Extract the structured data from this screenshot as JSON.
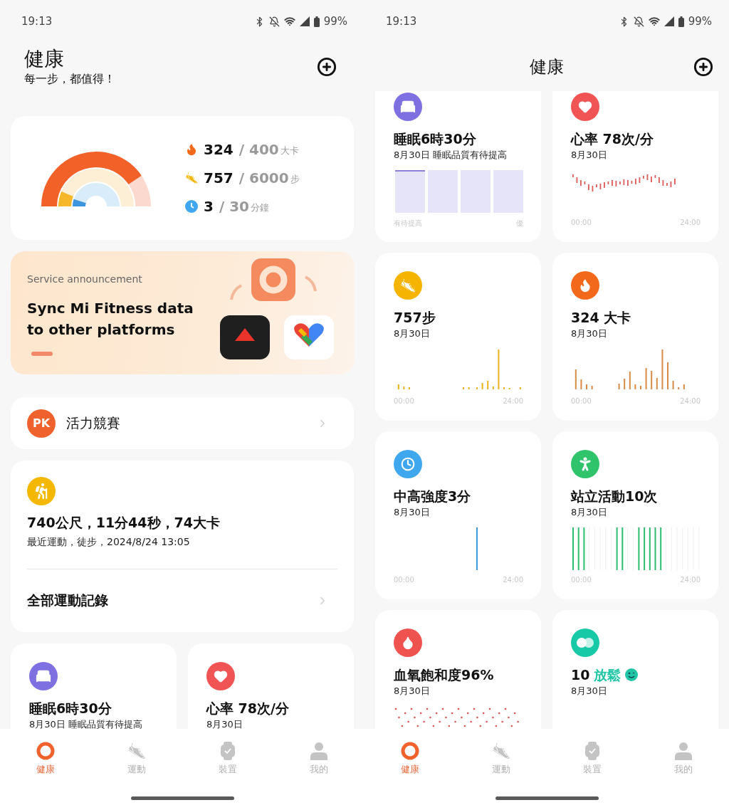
{
  "left_screen": {
    "status_bar": {
      "time": "19:13",
      "battery": "99%"
    },
    "header": {
      "title": "健康",
      "subtitle": "每一步，都值得！"
    },
    "goals": [
      {
        "kind": "calories",
        "value": "324",
        "target": "/ 400",
        "unit": "大卡"
      },
      {
        "kind": "steps",
        "value": "757",
        "target": "/ 6000",
        "unit": "步"
      },
      {
        "kind": "minutes",
        "value": "3",
        "target": "/ 30",
        "unit": "分鐘"
      }
    ],
    "announcement": {
      "label": "Service announcement",
      "title": "Sync Mi Fitness data to other platforms"
    },
    "challenge": {
      "badge": "PK",
      "label": "活力競賽"
    },
    "last_workout": {
      "summary": "740公尺，11分44秒，74大卡",
      "detail": "最近運動，徒步，2024/8/24 13:05",
      "link": "全部運動記錄"
    },
    "cards": [
      {
        "kind": "sleep",
        "title": "睡眠6時30分",
        "subtitle": "8月30日 睡眠品質有待提高"
      },
      {
        "kind": "heart_rate",
        "title": "心率 78次/分",
        "subtitle": "8月30日"
      }
    ],
    "nav": [
      {
        "kind": "health",
        "label": "健康",
        "selected": true
      },
      {
        "kind": "workout",
        "label": "運動",
        "selected": false
      },
      {
        "kind": "device",
        "label": "裝置",
        "selected": false
      },
      {
        "kind": "profile",
        "label": "我的",
        "selected": false
      }
    ]
  },
  "right_screen": {
    "status_bar": {
      "time": "19:13",
      "battery": "99%"
    },
    "header": {
      "title": "健康"
    },
    "cards": [
      {
        "kind": "sleep",
        "title": "睡眠6時30分",
        "subtitle": "8月30日 睡眠品質有待提高",
        "axis_start": "有待提高",
        "axis_end": "優"
      },
      {
        "kind": "heart_rate",
        "title": "心率 78次/分",
        "subtitle": "8月30日",
        "axis_start": "00:00",
        "axis_end": "24:00"
      },
      {
        "kind": "steps",
        "title": "757步",
        "subtitle": "8月30日",
        "axis_start": "00:00",
        "axis_end": "24:00"
      },
      {
        "kind": "calories",
        "title": "324 大卡",
        "subtitle": "8月30日",
        "axis_start": "00:00",
        "axis_end": "24:00"
      },
      {
        "kind": "intensity",
        "title": "中高強度3分",
        "subtitle": "8月30日",
        "axis_start": "00:00",
        "axis_end": "24:00"
      },
      {
        "kind": "standing",
        "title": "站立活動10次",
        "subtitle": "8月30日",
        "axis_start": "00:00",
        "axis_end": "24:00"
      },
      {
        "kind": "oxygen",
        "title": "血氧飽和度96%",
        "subtitle": "8月30日"
      },
      {
        "kind": "relax",
        "title": "10",
        "accent": "放鬆",
        "subtitle": "8月30日"
      }
    ],
    "nav": [
      {
        "kind": "health",
        "label": "健康",
        "selected": true
      },
      {
        "kind": "workout",
        "label": "運動",
        "selected": false
      },
      {
        "kind": "device",
        "label": "裝置",
        "selected": false
      },
      {
        "kind": "profile",
        "label": "我的",
        "selected": false
      }
    ]
  }
}
